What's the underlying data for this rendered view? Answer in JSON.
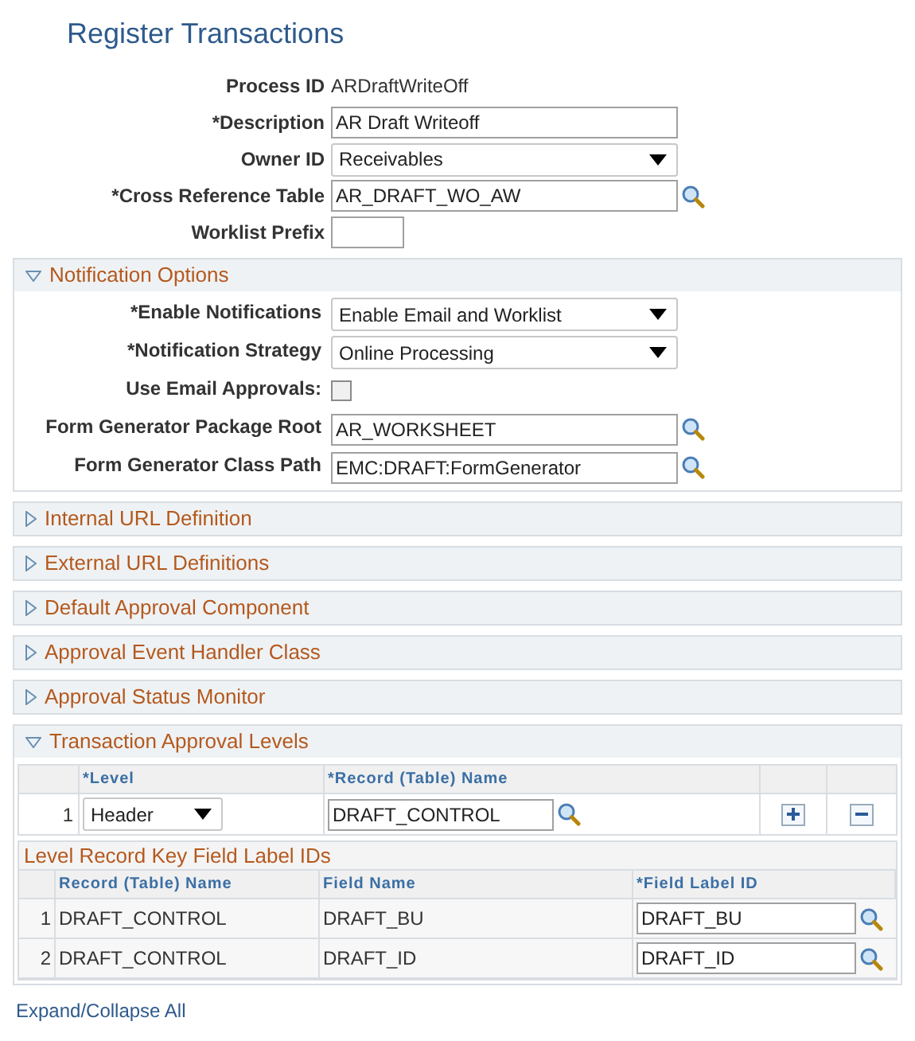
{
  "page_title": "Register Transactions",
  "header_fields": [
    {
      "label": "Process ID",
      "kind": "text",
      "value": "ARDraftWriteOff"
    },
    {
      "label": "*Description",
      "kind": "input",
      "value": "AR Draft Writeoff"
    },
    {
      "label": "Owner ID",
      "kind": "select",
      "value": "Receivables"
    },
    {
      "label": "*Cross Reference Table",
      "kind": "lookup",
      "value": "AR_DRAFT_WO_AW"
    },
    {
      "label": "Worklist Prefix",
      "kind": "short_input"
    }
  ],
  "sections": [
    {
      "title": "Notification Options",
      "expanded": true,
      "kind": "form",
      "fields": [
        {
          "label": "*Enable Notifications",
          "kind": "select",
          "value": "Enable Email and Worklist"
        },
        {
          "label": "*Notification Strategy",
          "kind": "select",
          "value": "Online Processing"
        },
        {
          "label": "Use Email Approvals:",
          "kind": "checkbox",
          "checked": false
        },
        {
          "label": "Form Generator Package Root",
          "kind": "lookup",
          "value": "AR_WORKSHEET"
        },
        {
          "label": "Form Generator Class Path",
          "kind": "lookup",
          "value": "EMC:DRAFT:FormGenerator"
        }
      ]
    },
    {
      "title": "Internal URL Definition",
      "expanded": false
    },
    {
      "title": "External URL Definitions",
      "expanded": false
    },
    {
      "title": "Default Approval Component",
      "expanded": false
    },
    {
      "title": "Approval Event Handler Class",
      "expanded": false
    },
    {
      "title": "Approval Status Monitor",
      "expanded": false
    },
    {
      "title": "Transaction Approval Levels",
      "expanded": true,
      "kind": "levels",
      "columns": [
        "*Level",
        "*Record (Table) Name"
      ],
      "rows": [
        {
          "number": "1",
          "level": "Header",
          "record": "DRAFT_CONTROL"
        }
      ],
      "key_fields": {
        "title": "Level Record Key Field Label IDs",
        "columns": [
          "Record (Table) Name",
          "Field Name",
          "*Field Label ID"
        ],
        "rows": [
          {
            "number": "1",
            "record": "DRAFT_CONTROL",
            "field": "DRAFT_BU",
            "label_id": "DRAFT_BU"
          },
          {
            "number": "2",
            "record": "DRAFT_CONTROL",
            "field": "DRAFT_ID",
            "label_id": "DRAFT_ID"
          }
        ]
      }
    }
  ],
  "footer_link": "Expand/Collapse All"
}
